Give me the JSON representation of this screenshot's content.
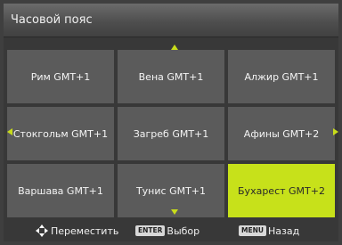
{
  "header": {
    "title": "Часовой пояс"
  },
  "grid": {
    "cells": [
      {
        "label": "Рим GMT+1"
      },
      {
        "label": "Вена GMT+1"
      },
      {
        "label": "Алжир GMT+1"
      },
      {
        "label": "Стокгольм GMT+1"
      },
      {
        "label": "Загреб GMT+1"
      },
      {
        "label": "Афины GMT+2"
      },
      {
        "label": "Варшава GMT+1"
      },
      {
        "label": "Тунис GMT+1"
      },
      {
        "label": "Бухарест GMT+2",
        "selected": true
      }
    ]
  },
  "footer": {
    "move_label": "Переместить",
    "enter_key": "ENTER",
    "select_label": "Выбор",
    "menu_key": "MENU",
    "back_label": "Назад"
  },
  "colors": {
    "selected": "#c7e11a",
    "cell": "#5b5b5b",
    "arrow": "#c8dc1a"
  }
}
